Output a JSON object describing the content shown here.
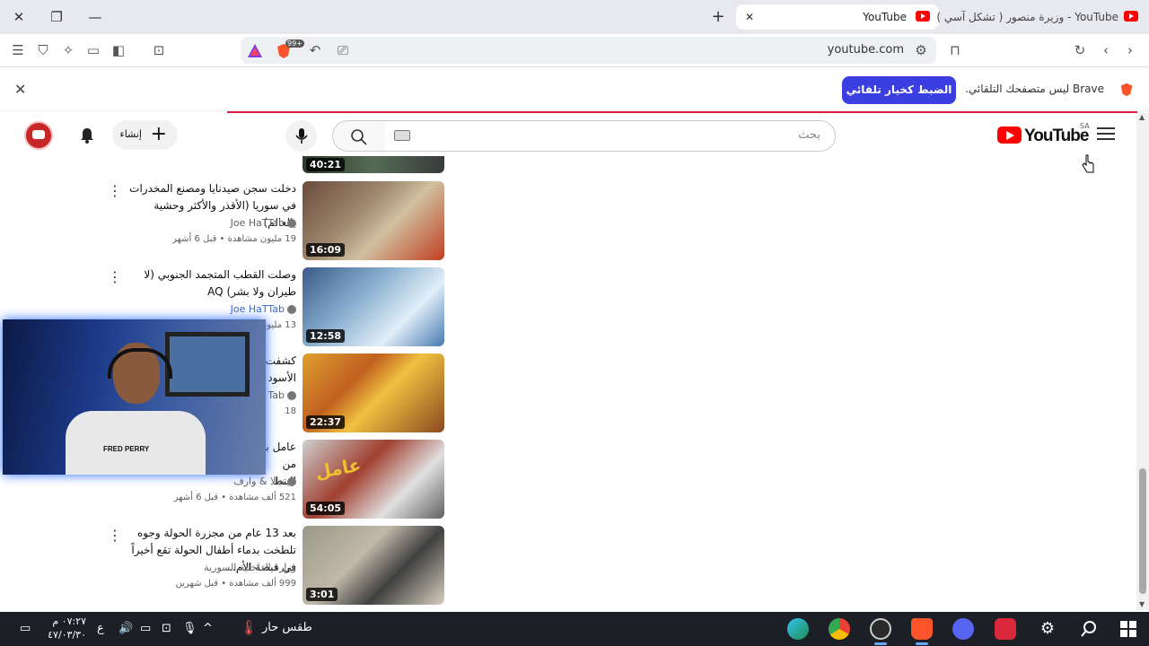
{
  "browser": {
    "tabs": [
      {
        "title": "YouTube",
        "active": true
      },
      {
        "title": "YouTube - وزيرة منصور ( تشكل آسي )",
        "active": false
      }
    ],
    "url": "youtube.com",
    "shields_count": "99+"
  },
  "notification": {
    "message": "Brave ليس متصفحك التلقائي.",
    "button_label": "الضبط كخيار تلقائي"
  },
  "youtube": {
    "logo_text": "YouTube",
    "country_code": "SA",
    "search_placeholder": "بحث",
    "create_label": "إنشاء"
  },
  "videos": [
    {
      "duration": "40:21",
      "title": "",
      "channel": "",
      "meta": ""
    },
    {
      "duration": "16:09",
      "title": "دخلت سجن صيدنايا ومصنع المخدرات في سوريا (الأقذر والأكثر وحشية بالعالم)",
      "channel": "Joe HaTTab",
      "meta": "19 مليون مشاهدة • قبل 6 أشهر"
    },
    {
      "duration": "12:58",
      "title": "وصلت القطب المتجمد الجنوبي (لا طيران ولا بشر) AQ",
      "channel": "Joe HaTTab",
      "meta": "13 مليون"
    },
    {
      "duration": "22:37",
      "title": "كشفت الأسود",
      "channel": "Tab",
      "meta": "18"
    },
    {
      "duration": "54:05",
      "title": "عامل بـ من البنط",
      "channel": "نيالا & وارف",
      "meta": "521 ألف مشاهدة • قبل 6 أشهر"
    },
    {
      "duration": "3:01",
      "title": "بعد 13 عام من مجزرة الحولة وجوه تلطخت بدماء أطفال الحولة تقع أخيراً في قبضة الأم...",
      "channel": "وزارة الداخلية السورية",
      "meta": "999 ألف مشاهدة • قبل شهرين"
    }
  ],
  "webcam": {
    "shirt_text": "FRED PERRY"
  },
  "taskbar": {
    "weather": "طقس حار",
    "time": "٠٧:٢٧ م",
    "date": "٤٧/٠٣/٣٠",
    "lang": "ع"
  }
}
